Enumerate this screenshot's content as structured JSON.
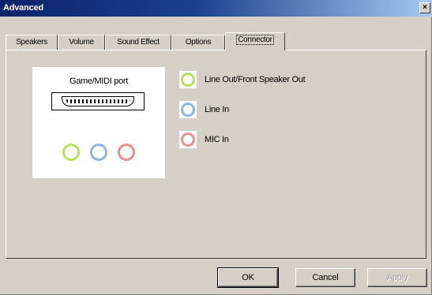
{
  "window": {
    "title": "Advanced",
    "close_glyph": "×"
  },
  "tabs": [
    {
      "label": "Speakers",
      "active": false
    },
    {
      "label": "Volume",
      "active": false
    },
    {
      "label": "Sound Effect",
      "active": false
    },
    {
      "label": "Options",
      "active": false
    },
    {
      "label": "Connector",
      "active": true
    }
  ],
  "connector": {
    "port_label": "Game/MIDI port",
    "jacks": [
      {
        "name": "Line Out/Front Speaker Out",
        "color": "#b8e05a"
      },
      {
        "name": "Line In",
        "color": "#8fb4e6"
      },
      {
        "name": "MIC In",
        "color": "#ec8c8c"
      }
    ]
  },
  "buttons": {
    "ok": "OK",
    "cancel": "Cancel",
    "apply": "Apply"
  }
}
